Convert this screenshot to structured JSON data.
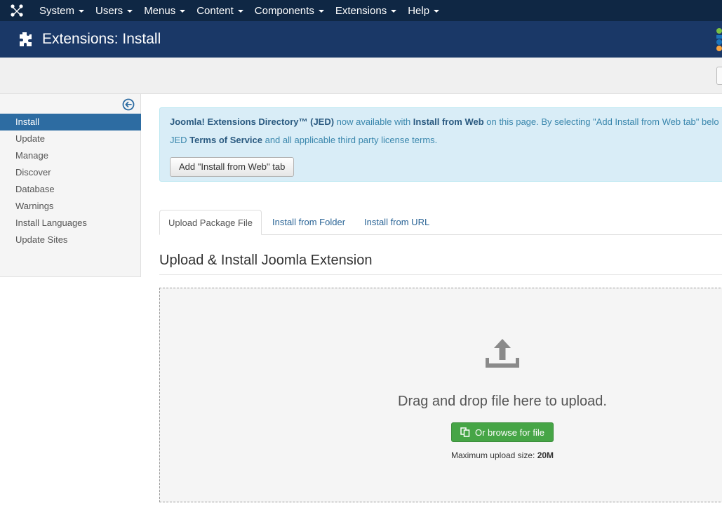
{
  "topnav": {
    "items": [
      "System",
      "Users",
      "Menus",
      "Content",
      "Components",
      "Extensions",
      "Help"
    ]
  },
  "header": {
    "title": "Extensions: Install"
  },
  "sidebar": {
    "items": [
      "Install",
      "Update",
      "Manage",
      "Discover",
      "Database",
      "Warnings",
      "Install Languages",
      "Update Sites"
    ],
    "active": "Install"
  },
  "alert": {
    "jed_name": "Joomla! Extensions Directory™ (JED)",
    "text_1": " now available with ",
    "install_from_web": "Install from Web",
    "text_2": " on this page. By selecting \"Add Install from Web tab\" belo",
    "text_3": "JED ",
    "tos": "Terms of Service",
    "text_4": " and all applicable third party license terms.",
    "button": "Add \"Install from Web\" tab"
  },
  "tabs": [
    "Upload Package File",
    "Install from Folder",
    "Install from URL"
  ],
  "section_title": "Upload & Install Joomla Extension",
  "dropzone": {
    "drop_text": "Drag and drop file here to upload.",
    "browse_label": "Or browse for file",
    "max_label": "Maximum upload size: ",
    "max_value": "20M"
  },
  "colors": {
    "topnav_bg": "#0f2744",
    "header_bg": "#1a3867",
    "sidebar_active": "#2d6ca2",
    "browse_button": "#46a546",
    "alert_bg": "#d9edf7"
  }
}
